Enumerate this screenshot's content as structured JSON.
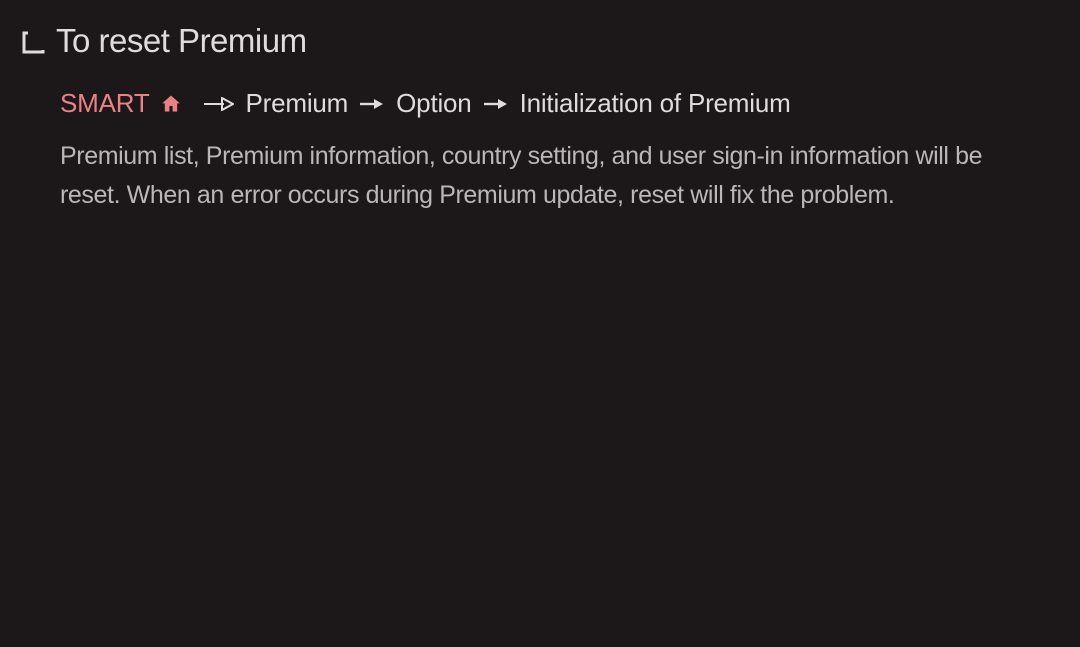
{
  "title": "To reset Premium",
  "path": {
    "smart": "SMART",
    "premium": "Premium",
    "option": "Option",
    "initialization": "Initialization of Premium"
  },
  "body": "Premium list, Premium information, country setting, and user sign-in information will be reset. When an error occurs during Premium update, reset will fix the problem."
}
